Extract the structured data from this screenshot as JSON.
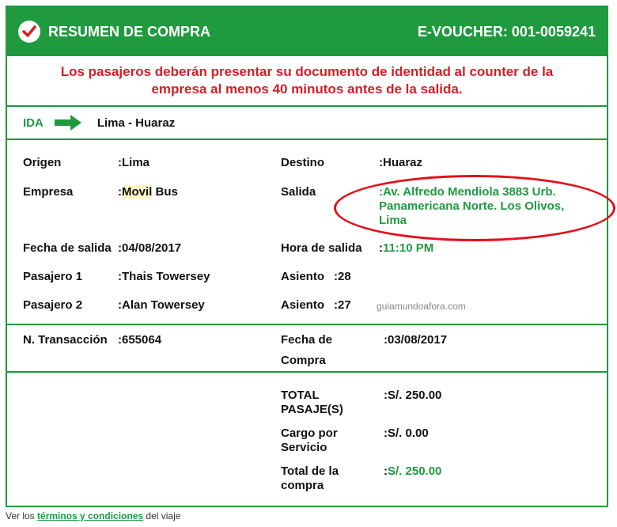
{
  "header": {
    "title": "RESUMEN DE COMPRA",
    "voucher": "E-VOUCHER: 001-0059241"
  },
  "notice": {
    "line1": "Los pasajeros deberán presentar su documento de identidad al counter de la",
    "line2": "empresa al menos 40 minutos antes de la salida."
  },
  "route": {
    "label": "IDA",
    "text": "Lima - Huaraz"
  },
  "details": {
    "origin_label": "Origen",
    "origin_value": ":Lima",
    "dest_label": "Destino",
    "dest_value": ":Huaraz",
    "company_label": "Empresa",
    "company_prefix": ":",
    "company_hl": "Movil",
    "company_rest": " Bus",
    "departure_label": "Salida",
    "departure_line1": ":Av. Alfredo Mendiola 3883 Urb.",
    "departure_line2": "Panamericana Norte. Los Olivos,",
    "departure_line3": "Lima",
    "date_label": "Fecha de salida",
    "date_value": ":04/08/2017",
    "time_label": "Hora de salida",
    "time_prefix": ":",
    "time_value": "11:10 PM",
    "p1_label": "Pasajero 1",
    "p1_value": ":Thais Towersey",
    "seat1_label": "Asiento",
    "seat1_value": ":28",
    "p2_label": "Pasajero 2",
    "p2_value": ":Alan Towersey",
    "seat2_label": "Asiento",
    "seat2_value": ":27",
    "watermark": "guiamundoafora.com"
  },
  "transaction": {
    "label": "N. Transacción",
    "value": ":655064",
    "purchase_label_1": "Fecha de",
    "purchase_label_2": "Compra",
    "purchase_value": ":03/08/2017"
  },
  "totals": {
    "ticket_label_1": "TOTAL",
    "ticket_label_2": "PASAJE(S)",
    "ticket_value": ":S/. 250.00",
    "service_label_1": "Cargo por",
    "service_label_2": "Servicio",
    "service_value": ":S/. 0.00",
    "total_label_1": "Total de la",
    "total_label_2": "compra",
    "total_prefix": ":",
    "total_value": "S/. 250.00"
  },
  "footer": {
    "prefix": "Ver los ",
    "link": "términos y condiciones",
    "suffix": " del viaje"
  },
  "colors": {
    "brand_green": "#1f9a3f",
    "alert_red": "#d41f26"
  }
}
